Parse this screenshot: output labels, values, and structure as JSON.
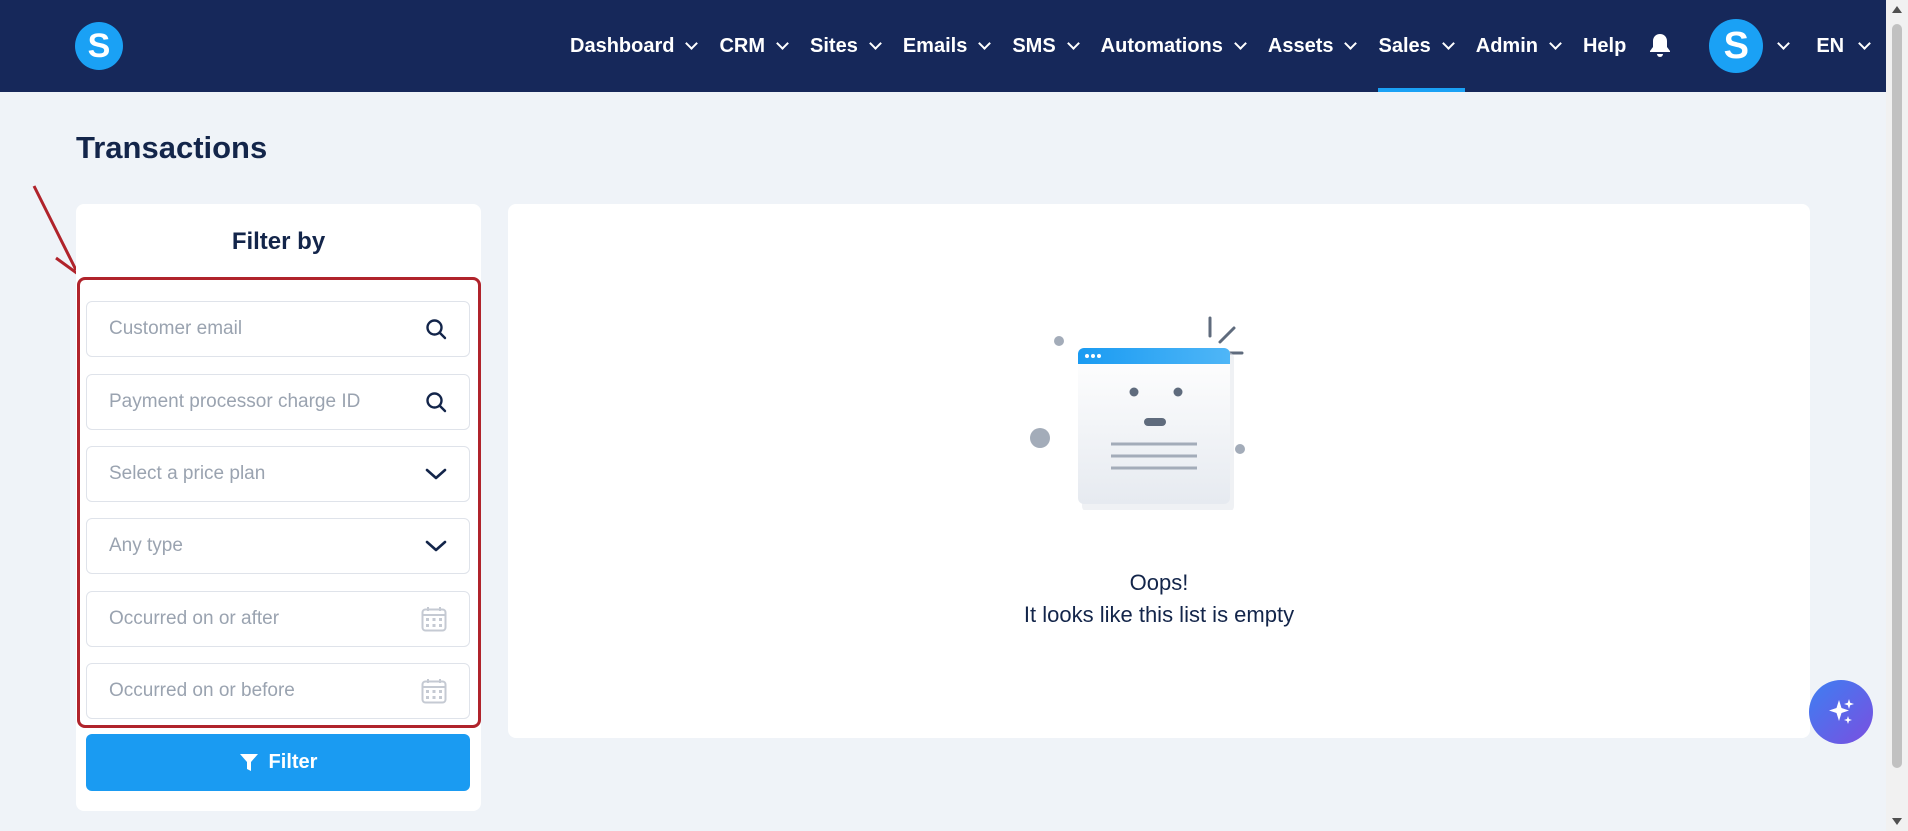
{
  "nav": {
    "logo": "S",
    "items": [
      {
        "label": "Dashboard",
        "dropdown": true,
        "active": false
      },
      {
        "label": "CRM",
        "dropdown": true,
        "active": false
      },
      {
        "label": "Sites",
        "dropdown": true,
        "active": false
      },
      {
        "label": "Emails",
        "dropdown": true,
        "active": false
      },
      {
        "label": "SMS",
        "dropdown": true,
        "active": false
      },
      {
        "label": "Automations",
        "dropdown": true,
        "active": false
      },
      {
        "label": "Assets",
        "dropdown": true,
        "active": false
      },
      {
        "label": "Sales",
        "dropdown": true,
        "active": true
      },
      {
        "label": "Admin",
        "dropdown": true,
        "active": false
      },
      {
        "label": "Help",
        "dropdown": false,
        "active": false
      }
    ],
    "avatar_initial": "S",
    "language": "EN"
  },
  "page": {
    "title": "Transactions"
  },
  "filter": {
    "title": "Filter by",
    "customer_email_placeholder": "Customer email",
    "charge_id_placeholder": "Payment processor charge ID",
    "price_plan_placeholder": "Select a price plan",
    "type_placeholder": "Any type",
    "occurred_after_placeholder": "Occurred on or after",
    "occurred_before_placeholder": "Occurred on or before",
    "button_label": "Filter"
  },
  "empty_state": {
    "line1": "Oops!",
    "line2": "It looks like this list is empty"
  },
  "colors": {
    "nav_bg": "#16285a",
    "accent": "#1aa1f5",
    "button": "#1a9bf2",
    "highlight": "#b0232b",
    "page_bg": "#eff3f8"
  },
  "icons": [
    "search-icon",
    "chevron-down-icon",
    "calendar-icon",
    "filter-icon",
    "bell-icon",
    "sparkle-icon"
  ]
}
